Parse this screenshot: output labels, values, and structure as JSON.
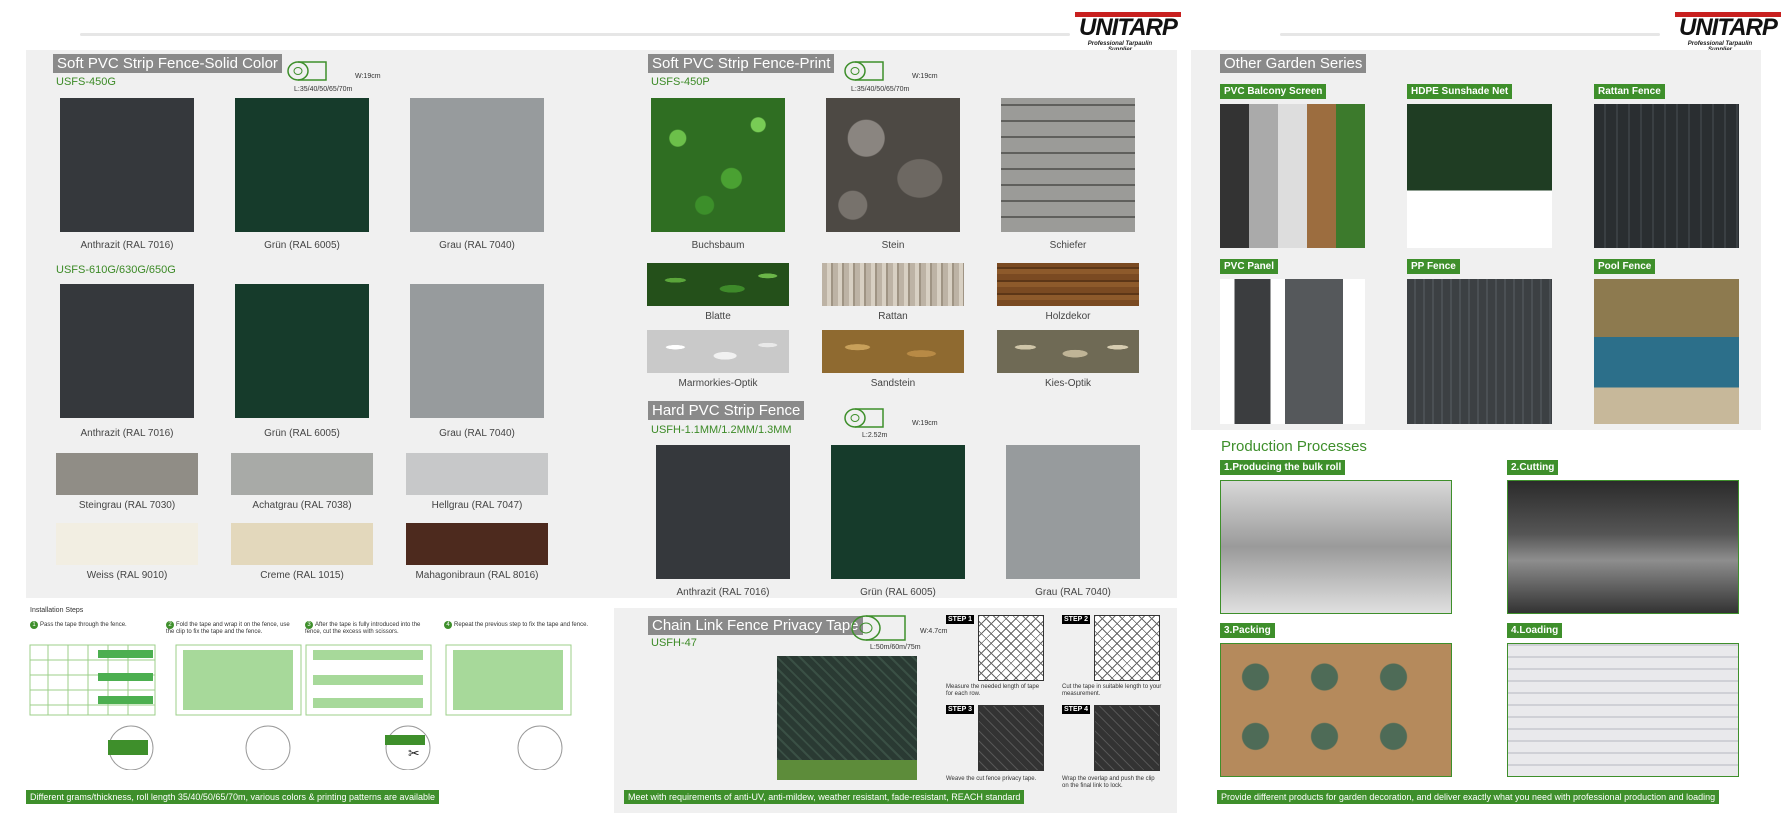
{
  "brand": {
    "name": "UNITARP",
    "tagline": "Professional Tarpaulin Supplier"
  },
  "solid": {
    "title": "Soft PVC Strip Fence-Solid Color",
    "roll_w": "W:19cm",
    "roll_l": "L:35/40/50/65/70m",
    "code1": "USFS-450G",
    "code2": "USFS-610G/630G/650G",
    "row1": [
      {
        "label": "Anthrazit (RAL 7016)",
        "color": "#35383c"
      },
      {
        "label": "Grün (RAL 6005)",
        "color": "#163b2b"
      },
      {
        "label": "Grau (RAL 7040)",
        "color": "#979b9d"
      }
    ],
    "row2": [
      {
        "label": "Anthrazit (RAL 7016)",
        "color": "#35383c"
      },
      {
        "label": "Grün (RAL 6005)",
        "color": "#163b2b"
      },
      {
        "label": "Grau (RAL 7040)",
        "color": "#979b9d"
      }
    ],
    "row3": [
      {
        "label": "Steingrau (RAL 7030)",
        "color": "#908d86"
      },
      {
        "label": "Achatgrau (RAL 7038)",
        "color": "#a8aaa7"
      },
      {
        "label": "Hellgrau (RAL 7047)",
        "color": "#c7c8c9"
      }
    ],
    "row4": [
      {
        "label": "Weiss (RAL 9010)",
        "color": "#f2eee2"
      },
      {
        "label": "Creme (RAL 1015)",
        "color": "#e3d8bc"
      },
      {
        "label": "Mahagonibraun (RAL 8016)",
        "color": "#4d2a1e"
      }
    ]
  },
  "print": {
    "title": "Soft PVC Strip Fence-Print",
    "roll_w": "W:19cm",
    "roll_l": "L:35/40/50/65/70m",
    "code": "USFS-450P",
    "row1": [
      "Buchsbaum",
      "Stein",
      "Schiefer"
    ],
    "row2": [
      "Blatte",
      "Rattan",
      "Holzdekor"
    ],
    "row3": [
      "Marmorkies-Optik",
      "Sandstein",
      "Kies-Optik"
    ]
  },
  "hard": {
    "title": "Hard PVC Strip Fence",
    "roll_w": "W:19cm",
    "roll_l": "L:2.52m",
    "code": "USFH-1.1MM/1.2MM/1.3MM",
    "items": [
      {
        "label": "Anthrazit (RAL 7016)",
        "color": "#35383c"
      },
      {
        "label": "Grün (RAL 6005)",
        "color": "#163b2b"
      },
      {
        "label": "Grau (RAL 7040)",
        "color": "#979b9d"
      }
    ]
  },
  "install": {
    "title": "Installation Steps",
    "steps": [
      {
        "num": "1",
        "text": "Pass the tape through the fence."
      },
      {
        "num": "2",
        "text": "Fold the tape and wrap it on the fence, use the clip to fix the tape and the fence."
      },
      {
        "num": "3",
        "text": "After the tape is fully introduced into the fence, cut the excess with scissors."
      },
      {
        "num": "4",
        "text": "Repeat the previous step to fix the tape and fence."
      }
    ],
    "footer": "Different grams/thickness, roll length 35/40/50/65/70m, various colors & printing patterns are available"
  },
  "chain": {
    "title": "Chain Link Fence Privacy Tape",
    "roll_w": "W:4.7cm",
    "roll_l": "L:50m/60m/75m",
    "code": "USFH-47",
    "steps": [
      {
        "tag": "STEP 1",
        "text": "Measure the needed length of tape for each row."
      },
      {
        "tag": "STEP 2",
        "text": "Cut the tape in suitable length to your measurement."
      },
      {
        "tag": "STEP 3",
        "text": "Weave the cut fence privacy tape."
      },
      {
        "tag": "STEP 4",
        "text": "Wrap the overlap and push the clip on the final link to lock."
      }
    ],
    "footer": "Meet with requirements of anti-UV, anti-mildew, weather resistant, fade-resistant, REACH standard"
  },
  "garden": {
    "title": "Other Garden Series",
    "items": [
      "PVC Balcony Screen",
      "HDPE Sunshade Net",
      "Rattan Fence",
      "PVC Panel",
      "PP Fence",
      "Pool Fence"
    ]
  },
  "production": {
    "title": "Production Processes",
    "steps": [
      "1.Producing the bulk roll",
      "2.Cutting",
      "3.Packing",
      "4.Loading"
    ],
    "footer": "Provide different products for garden decoration, and deliver exactly what you need with professional production and loading"
  }
}
